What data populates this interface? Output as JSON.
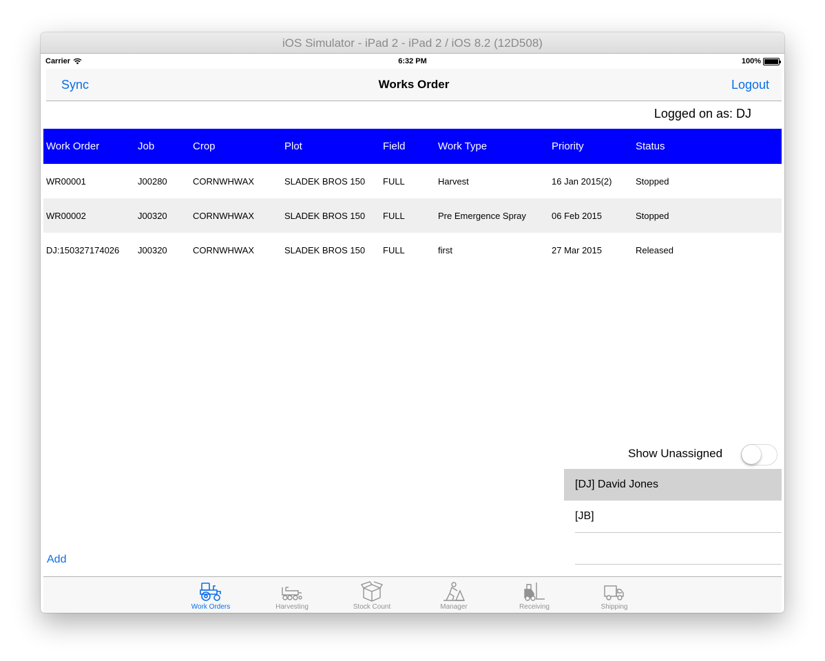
{
  "window": {
    "title": "iOS Simulator - iPad 2 - iPad 2 / iOS 8.2 (12D508)"
  },
  "status_bar": {
    "carrier": "Carrier",
    "time": "6:32 PM",
    "battery": "100%"
  },
  "navbar": {
    "left_button": "Sync",
    "title": "Works Order",
    "right_button": "Logout"
  },
  "session": {
    "logged_on": "Logged on as:  DJ"
  },
  "table": {
    "columns": [
      "Work Order",
      "Job",
      "Crop",
      "Plot",
      "Field",
      "Work Type",
      "Priority",
      "Status"
    ],
    "rows": [
      [
        "WR00001",
        "J00280",
        "CORNWHWAX",
        "SLADEK BROS 150",
        "FULL",
        "Harvest",
        "16 Jan 2015(2)",
        "Stopped"
      ],
      [
        "WR00002",
        "J00320",
        "CORNWHWAX",
        "SLADEK BROS 150",
        "FULL",
        "Pre Emergence Spray",
        "06 Feb 2015",
        "Stopped"
      ],
      [
        "DJ:150327174026",
        "J00320",
        "CORNWHWAX",
        "SLADEK BROS 150",
        "FULL",
        "first",
        "27 Mar 2015",
        "Released"
      ]
    ],
    "header_color": "#0000ff"
  },
  "assign_panel": {
    "show_unassigned_label": "Show Unassigned",
    "show_unassigned": false,
    "users": [
      "[DJ] David Jones",
      "[JB]"
    ]
  },
  "footer": {
    "add_label": "Add"
  },
  "tabbar": {
    "items": [
      {
        "label": "Work Orders",
        "icon": "tractor-icon"
      },
      {
        "label": "Harvesting",
        "icon": "harvester-icon"
      },
      {
        "label": "Stock Count",
        "icon": "box-icon"
      },
      {
        "label": "Manager",
        "icon": "worker-icon"
      },
      {
        "label": "Receiving",
        "icon": "forklift-icon"
      },
      {
        "label": "Shipping",
        "icon": "truck-icon"
      }
    ],
    "active_color": "#0a6ee8",
    "inactive_color": "#929292"
  }
}
